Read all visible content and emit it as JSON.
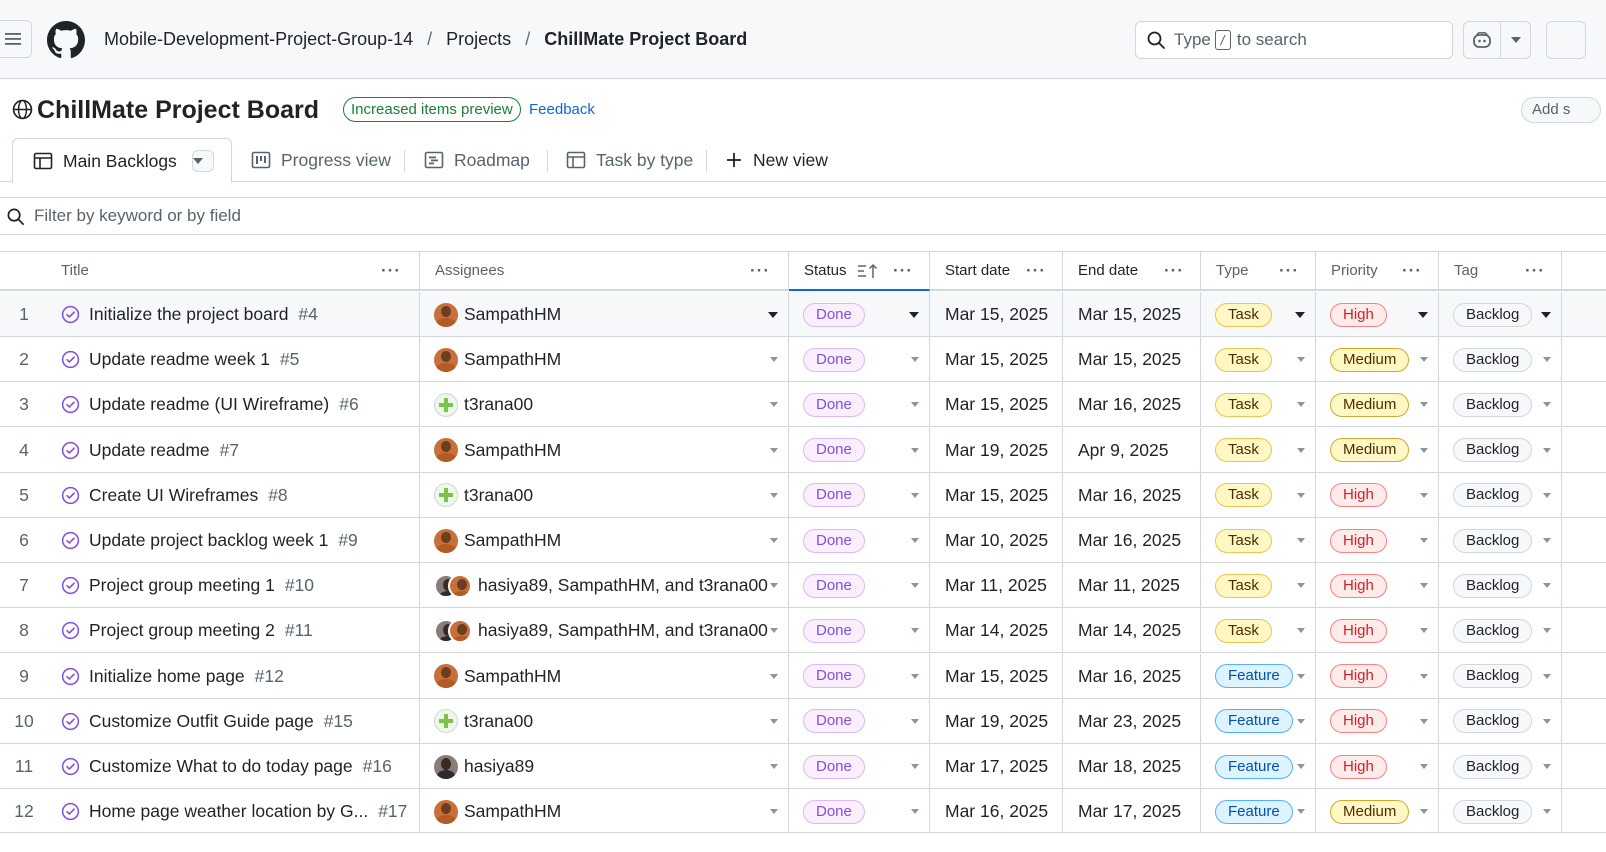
{
  "breadcrumbs": [
    "Mobile-Development-Project-Group-14",
    "Projects",
    "ChillMate Project Board"
  ],
  "search": {
    "prefix": "Type",
    "key": "/",
    "suffix": "to search"
  },
  "project": {
    "title": "ChillMate Project Board",
    "badge": "Increased items preview",
    "feedback": "Feedback",
    "add_label": "Add s"
  },
  "tabs": [
    {
      "label": "Main Backlogs",
      "icon": "table-icon"
    },
    {
      "label": "Progress view",
      "icon": "board-icon"
    },
    {
      "label": "Roadmap",
      "icon": "roadmap-icon"
    },
    {
      "label": "Task by type",
      "icon": "table-icon"
    },
    {
      "label": "New view",
      "icon": "plus-icon"
    }
  ],
  "filter": {
    "placeholder": "Filter by keyword or by field"
  },
  "columns": {
    "title": "Title",
    "assignees": "Assignees",
    "status": "Status",
    "start": "Start date",
    "end": "End date",
    "type": "Type",
    "priority": "Priority",
    "tag": "Tag"
  },
  "colors": {
    "done": "#8250df",
    "accent": "#0969da",
    "badge_green": "#1a7f37"
  },
  "rows": [
    {
      "num": "1",
      "title": "Initialize the project board",
      "issue": "#4",
      "assignees": "SampathHM",
      "avatar": "samp",
      "status": "Done",
      "start": "Mar 15, 2025",
      "end": "Mar 15, 2025",
      "type": "Task",
      "priority": "High",
      "tag": "Backlog"
    },
    {
      "num": "2",
      "title": "Update readme week 1",
      "issue": "#5",
      "assignees": "SampathHM",
      "avatar": "samp",
      "status": "Done",
      "start": "Mar 15, 2025",
      "end": "Mar 15, 2025",
      "type": "Task",
      "priority": "Medium",
      "tag": "Backlog"
    },
    {
      "num": "3",
      "title": "Update readme (UI Wireframe)",
      "issue": "#6",
      "assignees": "t3rana00",
      "avatar": "t3",
      "status": "Done",
      "start": "Mar 15, 2025",
      "end": "Mar 16, 2025",
      "type": "Task",
      "priority": "Medium",
      "tag": "Backlog"
    },
    {
      "num": "4",
      "title": "Update readme",
      "issue": "#7",
      "assignees": "SampathHM",
      "avatar": "samp",
      "status": "Done",
      "start": "Mar 19, 2025",
      "end": "Apr 9, 2025",
      "type": "Task",
      "priority": "Medium",
      "tag": "Backlog"
    },
    {
      "num": "5",
      "title": "Create UI Wireframes",
      "issue": "#8",
      "assignees": "t3rana00",
      "avatar": "t3",
      "status": "Done",
      "start": "Mar 15, 2025",
      "end": "Mar 16, 2025",
      "type": "Task",
      "priority": "High",
      "tag": "Backlog"
    },
    {
      "num": "6",
      "title": "Update project backlog week 1",
      "issue": "#9",
      "assignees": "SampathHM",
      "avatar": "samp",
      "status": "Done",
      "start": "Mar 10, 2025",
      "end": "Mar 16, 2025",
      "type": "Task",
      "priority": "High",
      "tag": "Backlog"
    },
    {
      "num": "7",
      "title": "Project group meeting 1",
      "issue": "#10",
      "assignees": "hasiya89, SampathHM, and t3rana00",
      "avatar": "multi",
      "status": "Done",
      "start": "Mar 11, 2025",
      "end": "Mar 11, 2025",
      "type": "Task",
      "priority": "High",
      "tag": "Backlog"
    },
    {
      "num": "8",
      "title": "Project group meeting 2",
      "issue": "#11",
      "assignees": "hasiya89, SampathHM, and t3rana00",
      "avatar": "multi",
      "status": "Done",
      "start": "Mar 14, 2025",
      "end": "Mar 14, 2025",
      "type": "Task",
      "priority": "High",
      "tag": "Backlog"
    },
    {
      "num": "9",
      "title": "Initialize home page",
      "issue": "#12",
      "assignees": "SampathHM",
      "avatar": "samp",
      "status": "Done",
      "start": "Mar 15, 2025",
      "end": "Mar 16, 2025",
      "type": "Feature",
      "priority": "High",
      "tag": "Backlog"
    },
    {
      "num": "10",
      "title": "Customize Outfit Guide page",
      "issue": "#15",
      "assignees": "t3rana00",
      "avatar": "t3",
      "status": "Done",
      "start": "Mar 19, 2025",
      "end": "Mar 23, 2025",
      "type": "Feature",
      "priority": "High",
      "tag": "Backlog"
    },
    {
      "num": "11",
      "title": "Customize What to do today page",
      "issue": "#16",
      "assignees": "hasiya89",
      "avatar": "has",
      "status": "Done",
      "start": "Mar 17, 2025",
      "end": "Mar 18, 2025",
      "type": "Feature",
      "priority": "High",
      "tag": "Backlog"
    },
    {
      "num": "12",
      "title": "Home page weather location by G...",
      "issue": "#17",
      "assignees": "SampathHM",
      "avatar": "samp",
      "status": "Done",
      "start": "Mar 16, 2025",
      "end": "Mar 17, 2025",
      "type": "Feature",
      "priority": "Medium",
      "tag": "Backlog"
    }
  ]
}
